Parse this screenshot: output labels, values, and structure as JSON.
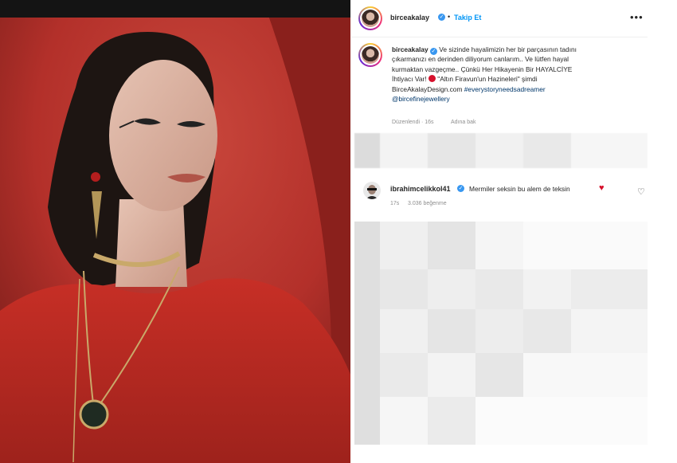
{
  "post": {
    "username": "birceakalay",
    "follow_label": "Takip Et",
    "more_label": "•••",
    "caption": {
      "line1": "Ve sizinde hayalimizin her bir parçasının tadını",
      "line2": "çıkarmanızı en derinden diliyorum canlarım.. Ve lütfen hayal",
      "line3": "kurmaktan vazgeçme.. Çünkü Her Hikayenin Bir HAYALCİYE",
      "line4a": "İhtiyacı Var! ",
      "line4b": " \"Altın Firavun'un Hazineleri\" şimdi",
      "line5a": "BirceAkalayDesign.com ",
      "line5_hashtag": "#everystoryneedsadreamer",
      "line6_mention": "@bircefinejewellery"
    },
    "meta": {
      "edited": "Düzenlendi · 16s",
      "translate": "Adına bak"
    }
  },
  "comment": {
    "username": "ibrahimcelikkol41",
    "text": "Mermiler seksin bu alem de teksin",
    "time": "17s",
    "likes": "3.036 beğenme"
  },
  "icons": {
    "verified": "✓",
    "heart": "♥",
    "heart_outline": "♡"
  },
  "colors": {
    "photo_background": "#b8302a",
    "link": "#0095f6",
    "hashtag": "#00376b",
    "verified": "#3897f0"
  }
}
